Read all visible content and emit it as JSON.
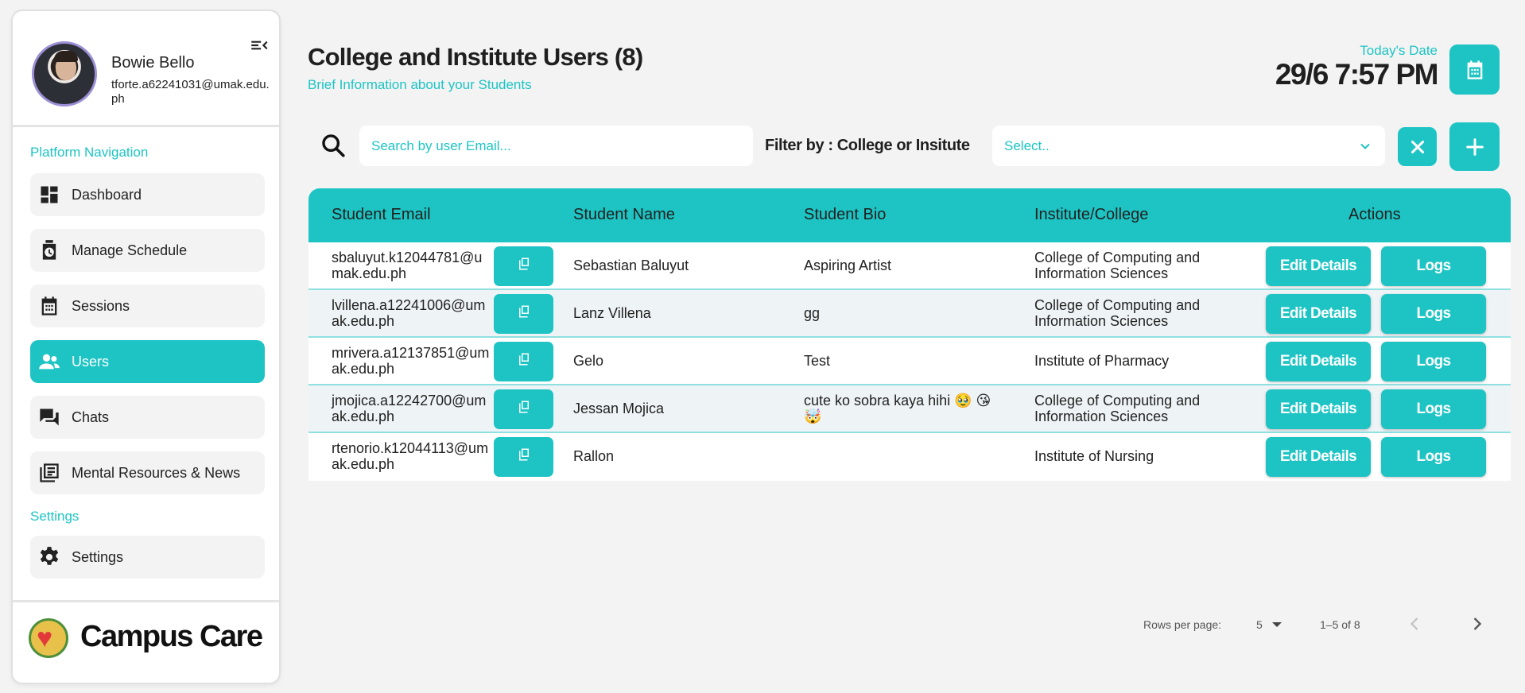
{
  "profile": {
    "name": "Bowie Bello",
    "email": "tforte.a62241031@umak.edu.ph"
  },
  "sidebar": {
    "section_navigation": "Platform Navigation",
    "section_settings": "Settings",
    "items": [
      {
        "label": "Dashboard",
        "icon": "dashboard-icon"
      },
      {
        "label": "Manage Schedule",
        "icon": "schedule-icon"
      },
      {
        "label": "Sessions",
        "icon": "calendar-icon"
      },
      {
        "label": "Users",
        "icon": "users-icon",
        "active": true
      },
      {
        "label": "Chats",
        "icon": "chat-icon"
      },
      {
        "label": "Mental Resources & News",
        "icon": "news-icon"
      }
    ],
    "settings_item": {
      "label": "Settings",
      "icon": "gear-icon"
    }
  },
  "brand": {
    "name": "Campus Care"
  },
  "header": {
    "title": "College and Institute Users (8)",
    "subtitle": "Brief Information about your Students",
    "date_label": "Today's Date",
    "date_value": "29/6 7:57 PM"
  },
  "toolbar": {
    "search_placeholder": "Search by user Email...",
    "filter_label": "Filter by : College or Insitute",
    "filter_value": "Select.."
  },
  "table": {
    "columns": [
      "Student Email",
      "Student Name",
      "Student Bio",
      "Institute/College",
      "Actions"
    ],
    "edit_label": "Edit Details",
    "logs_label": "Logs",
    "rows": [
      {
        "email": "sbaluyut.k12044781@umak.edu.ph",
        "name": "Sebastian Baluyut",
        "bio": "Aspiring Artist",
        "institute": "College of Computing and Information Sciences"
      },
      {
        "email": "lvillena.a12241006@umak.edu.ph",
        "name": "Lanz Villena",
        "bio": "gg",
        "institute": "College of Computing and Information Sciences"
      },
      {
        "email": "mrivera.a12137851@umak.edu.ph",
        "name": "Gelo",
        "bio": "Test",
        "institute": "Institute of Pharmacy"
      },
      {
        "email": "jmojica.a12242700@umak.edu.ph",
        "name": "Jessan Mojica",
        "bio": "cute ko sobra kaya hihi 🥹 😘 🤯",
        "institute": "College of Computing and Information Sciences"
      },
      {
        "email": "rtenorio.k12044113@umak.edu.ph",
        "name": "Rallon",
        "bio": "",
        "institute": "Institute of Nursing"
      }
    ]
  },
  "pagination": {
    "rows_per_page_label": "Rows per page:",
    "rows_per_page_value": "5",
    "range": "1–5 of 8"
  },
  "colors": {
    "accent": "#1ec4c4",
    "background": "#f3f3f3",
    "row_alt": "#eef3f6"
  }
}
